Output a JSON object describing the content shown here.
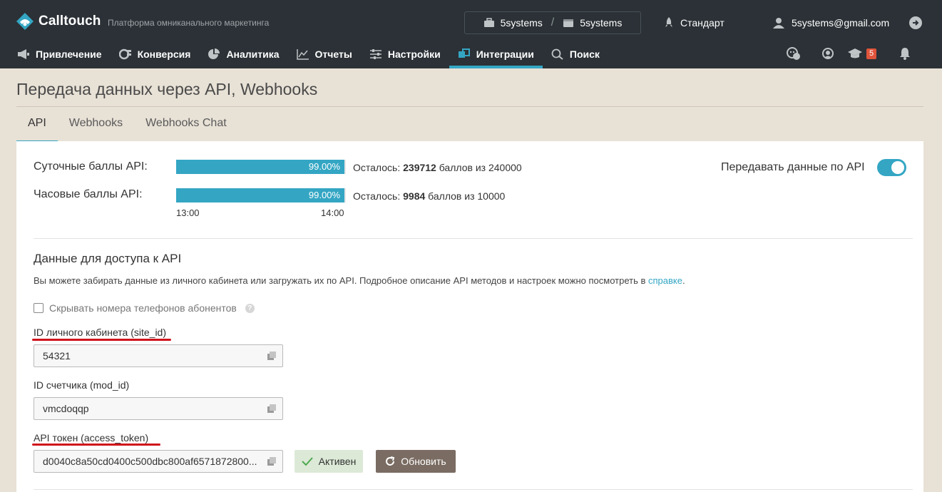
{
  "app": {
    "name": "Calltouch",
    "tagline": "Платформа омниканального маркетинга",
    "account": "5systems",
    "project": "5systems",
    "tariff": "Стандарт",
    "user_email": "5systems@gmail.com"
  },
  "nav": {
    "items": [
      {
        "label": "Привлечение",
        "icon": "megaphone-icon"
      },
      {
        "label": "Конверсия",
        "icon": "conversion-icon"
      },
      {
        "label": "Аналитика",
        "icon": "pie-chart-icon"
      },
      {
        "label": "Отчеты",
        "icon": "line-chart-icon"
      },
      {
        "label": "Настройки",
        "icon": "sliders-icon"
      },
      {
        "label": "Интеграции",
        "icon": "integration-icon"
      },
      {
        "label": "Поиск",
        "icon": "search-icon"
      }
    ],
    "active": "Интеграции",
    "notifications_count": "5"
  },
  "page": {
    "title": "Передача данных через API, Webhooks",
    "tabs": [
      "API",
      "Webhooks",
      "Webhooks Chat"
    ],
    "active_tab": "API"
  },
  "limits": {
    "daily_label": "Суточные баллы API:",
    "daily_percent": "99.00%",
    "daily_fill": 0.99,
    "daily_remain_prefix": "Осталось:",
    "daily_remain_value": "239712",
    "daily_remain_suffix": "баллов из 240000",
    "hourly_label": "Часовые баллы API:",
    "hourly_percent": "99.00%",
    "hourly_fill": 0.99,
    "hourly_remain_prefix": "Осталось:",
    "hourly_remain_value": "9984",
    "hourly_remain_suffix": "баллов из 10000",
    "time_start": "13:00",
    "time_end": "14:00"
  },
  "toggle": {
    "label": "Передавать данные по API",
    "on": true
  },
  "access": {
    "title": "Данные для доступа к API",
    "description": "Вы можете забирать данные из личного кабинета или загружать их по API. Подробное описание API методов и настроек можно посмотреть в",
    "link_text": "справке",
    "link_suffix": ".",
    "hide_phones_label": "Скрывать номера телефонов абонентов",
    "hide_phones_checked": false,
    "site_id_label": "ID личного кабинета (site_id)",
    "site_id_value": "54321",
    "mod_id_label": "ID счетчика (mod_id)",
    "mod_id_value": "vmcdoqqp",
    "token_label": "API токен (access_token)",
    "token_value": "d0040c8a50cd0400c500dbc800af6571872800...",
    "status_label": "Активен",
    "refresh_label": "Обновить"
  },
  "colors": {
    "accent": "#34a6c4",
    "topbar": "#2b3136",
    "page_bg": "#e8e1d6",
    "annotation_red": "#d0131b"
  }
}
